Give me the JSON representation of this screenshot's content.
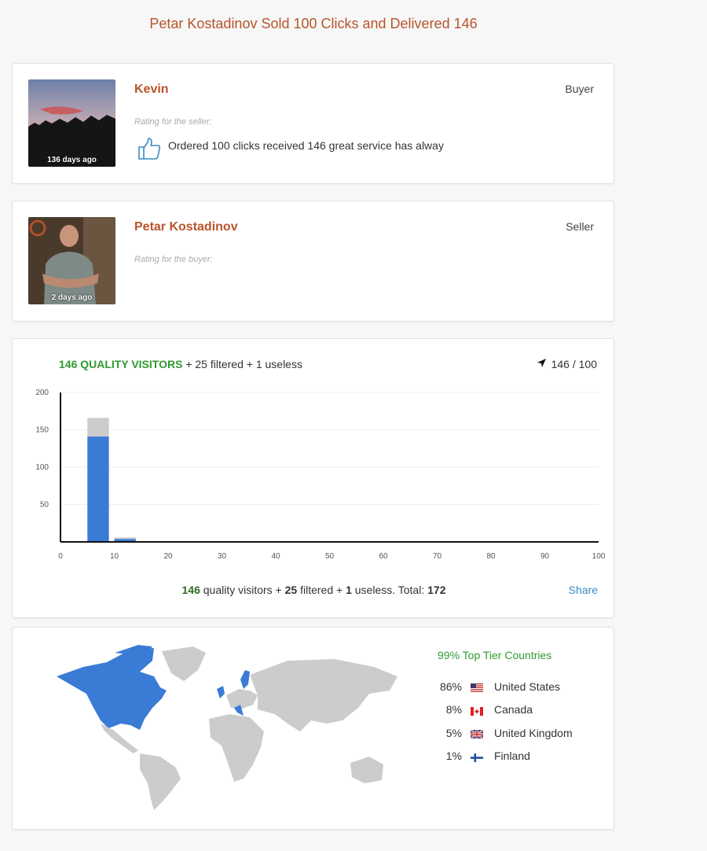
{
  "page": {
    "title": "Petar Kostadinov Sold 100 Clicks and Delivered 146"
  },
  "reviews": [
    {
      "name": "Kevin",
      "role": "Buyer",
      "age": "136 days ago",
      "rating_label": "Rating for the seller:",
      "text": "Ordered 100 clicks received 146 great service has alway"
    },
    {
      "name": "Petar Kostadinov",
      "role": "Seller",
      "age": "2 days ago",
      "rating_label": "Rating for the buyer:",
      "text": ""
    }
  ],
  "visitors": {
    "quality_label": "146 QUALITY VISITORS",
    "header_rest": "+ 25 filtered + 1 useless",
    "progress": "146 / 100",
    "footer": {
      "quality": "146",
      "t1": "quality visitors +",
      "filtered": "25",
      "t2": "filtered +",
      "useless": "1",
      "t3": "useless. Total:",
      "total": "172"
    },
    "share_label": "Share"
  },
  "chart_data": {
    "type": "bar",
    "stacked": true,
    "x": [
      7,
      12
    ],
    "x_ticks": [
      0,
      10,
      20,
      30,
      40,
      50,
      60,
      70,
      80,
      90,
      100
    ],
    "y_ticks": [
      50,
      100,
      150,
      200
    ],
    "xlim": [
      0,
      100
    ],
    "ylim": [
      0,
      200
    ],
    "grid": true,
    "series": [
      {
        "values": [
          141,
          4
        ],
        "color": "#3a7bd5"
      },
      {
        "values": [
          25,
          2
        ],
        "color": "#cccccc"
      }
    ]
  },
  "countries": {
    "summary": "99% Top Tier Countries",
    "items": [
      {
        "pct": "86%",
        "name": "United States",
        "flag": "us-flag-icon"
      },
      {
        "pct": "8%",
        "name": "Canada",
        "flag": "ca-flag-icon"
      },
      {
        "pct": "5%",
        "name": "United Kingdom",
        "flag": "uk-flag-icon"
      },
      {
        "pct": "1%",
        "name": "Finland",
        "flag": "fi-flag-icon"
      }
    ]
  }
}
